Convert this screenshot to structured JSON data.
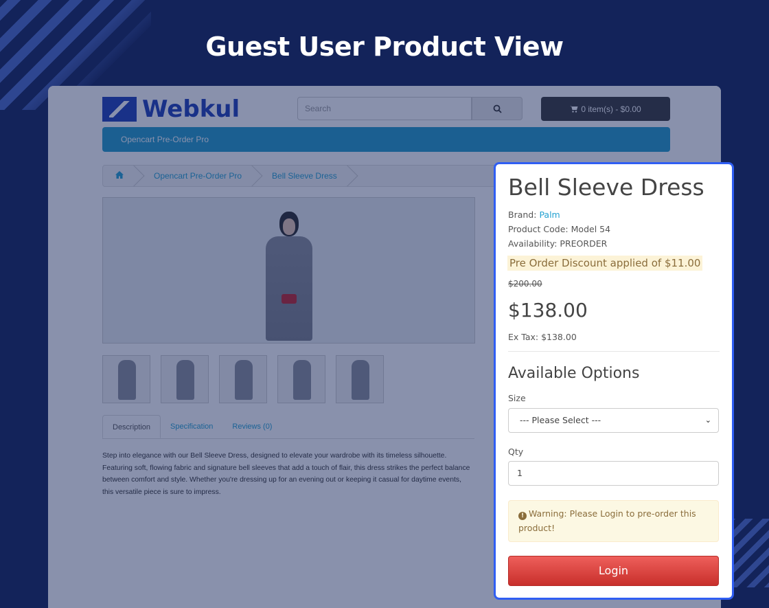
{
  "banner": {
    "title": "Guest User Product View"
  },
  "header": {
    "logo_text": "Webkul",
    "search_placeholder": "Search",
    "search_icon": "search-icon",
    "cart_label": "0 item(s) - $0.00",
    "cart_icon": "shopping-cart-icon"
  },
  "menu": {
    "item": "Opencart Pre-Order Pro"
  },
  "breadcrumb": {
    "home_icon": "home-icon",
    "items": [
      "Opencart Pre-Order Pro",
      "Bell Sleeve Dress"
    ]
  },
  "tabs": [
    {
      "label": "Description",
      "active": true
    },
    {
      "label": "Specification",
      "active": false
    },
    {
      "label": "Reviews (0)",
      "active": false
    }
  ],
  "description": "Step into elegance with our Bell Sleeve Dress, designed to elevate your wardrobe with its timeless silhouette. Featuring soft, flowing fabric and signature bell sleeves that add a touch of flair, this dress strikes the perfect balance between comfort and style. Whether you're dressing up for an evening out or keeping it casual for daytime events, this versatile piece is sure to impress.",
  "product": {
    "title": "Bell Sleeve Dress",
    "brand_label": "Brand:",
    "brand_value": "Palm",
    "code_label": "Product Code:",
    "code_value": "Model 54",
    "availability_label": "Availability:",
    "availability_value": "PREORDER",
    "discount_text": "Pre Order Discount applied of $11.00",
    "old_price": "$200.00",
    "price": "$138.00",
    "ex_tax": "Ex Tax: $138.00",
    "options_heading": "Available Options",
    "size_label": "Size",
    "size_selected": "--- Please Select ---",
    "qty_label": "Qty",
    "qty_value": "1",
    "warning": "Warning: Please Login to pre-order this product!",
    "login_label": "Login"
  },
  "colors": {
    "accent": "#2f5ef3",
    "menu": "#229ac8",
    "login": "#d9534f",
    "background": "#13235a"
  }
}
